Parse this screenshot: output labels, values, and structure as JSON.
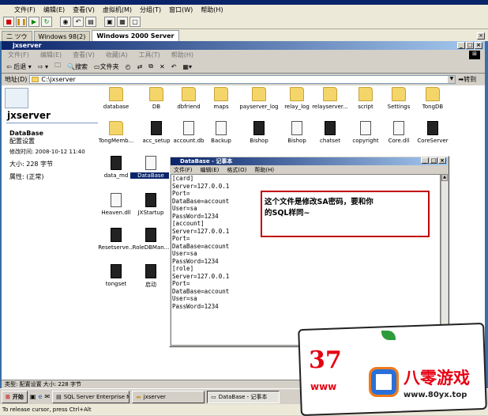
{
  "host": {
    "menu": [
      "文件(F)",
      "编辑(E)",
      "查看(V)",
      "虚拟机(M)",
      "分组(T)",
      "窗口(W)",
      "帮助(H)"
    ],
    "tabs": [
      {
        "label": "二 ツウ"
      },
      {
        "label": "Windows 98(2)"
      },
      {
        "label": "Windows 2000 Server",
        "active": true
      }
    ],
    "status_text": "To release cursor, press Ctrl+Alt"
  },
  "explorer": {
    "title": "jxserver",
    "menu": [
      "文件(F)",
      "编辑(E)",
      "查看(V)",
      "收藏(A)",
      "工具(T)",
      "帮助(H)"
    ],
    "toolbar": {
      "back": "后退",
      "search": "搜索",
      "folders": "文件夹"
    },
    "address_label": "地址(D)",
    "address_value": "C:\\jxserver",
    "go_label": "转到",
    "panel": {
      "folder_name": "jxserver",
      "file_name": "DataBase",
      "file_type": "配置设置",
      "modified": "修改时间: 2008-10-12 11:40",
      "size": "大小: 228 字节",
      "attributes": "属性: (正常)"
    },
    "icons": [
      {
        "label": "database",
        "kind": "folder"
      },
      {
        "label": "DB",
        "kind": "folder"
      },
      {
        "label": "dbfriend",
        "kind": "folder"
      },
      {
        "label": "maps",
        "kind": "folder"
      },
      {
        "label": "payserver_log",
        "kind": "folder"
      },
      {
        "label": "relay_log",
        "kind": "folder"
      },
      {
        "label": "relayserver...",
        "kind": "folder"
      },
      {
        "label": "script",
        "kind": "folder"
      },
      {
        "label": "Settings",
        "kind": "folder"
      },
      {
        "label": "TongDB",
        "kind": "folder"
      },
      {
        "label": "TongMemb...",
        "kind": "folder"
      },
      {
        "label": "acc_setup",
        "kind": "exe"
      },
      {
        "label": "account.db",
        "kind": "doc"
      },
      {
        "label": "Backup",
        "kind": "doc"
      },
      {
        "label": "Bishop",
        "kind": "exe"
      },
      {
        "label": "Bishop",
        "kind": "cfg"
      },
      {
        "label": "chatset",
        "kind": "exe"
      },
      {
        "label": "copyright",
        "kind": "doc"
      },
      {
        "label": "Core.dll",
        "kind": "dll"
      },
      {
        "label": "CoreServer",
        "kind": "exe"
      },
      {
        "label": "data_md",
        "kind": "exe"
      },
      {
        "label": "DataBase",
        "kind": "cfg",
        "selected": true
      },
      {
        "label": "Heaven.dll",
        "kind": "dll"
      },
      {
        "label": "JXStartup",
        "kind": "exe"
      },
      {
        "label": "Resetserve...",
        "kind": "exe"
      },
      {
        "label": "RoleDBMan...",
        "kind": "exe"
      },
      {
        "label": "tongset",
        "kind": "exe"
      },
      {
        "label": "启动",
        "kind": "exe"
      }
    ],
    "status": "类型: 配置设置 大小: 228 字节"
  },
  "notepad": {
    "title": "DataBase - 记事本",
    "menu": [
      "文件(F)",
      "编辑(E)",
      "格式(O)",
      "帮助(H)"
    ],
    "lines": [
      "[card]",
      "Server=127.0.0.1",
      "Port=",
      "DataBase=account",
      "User=sa",
      "PassWord=1234",
      "[account]",
      "Server=127.0.0.1",
      "Port=",
      "DataBase=account",
      "User=sa",
      "PassWord=1234",
      "[role]",
      "Server=127.0.0.1",
      "Port=",
      "DataBase=account",
      "User=sa",
      "PassWord=1234"
    ]
  },
  "annotation": {
    "line1": "这个文件是修改SA密码，要和你",
    "line2": "的SQL样同~"
  },
  "taskbar": {
    "start": "开始",
    "items": [
      {
        "label": "SQL Server Enterprise Ma..."
      },
      {
        "label": "jxserver"
      },
      {
        "label": "DataBase - 记事本",
        "active": true
      }
    ]
  },
  "watermark": {
    "number": "37",
    "brand": "八零游戏",
    "url": "www.80yx.top",
    "partial": "www"
  },
  "colors": {
    "annotation_border": "#c00000",
    "titlebar": "#0a246a",
    "brand_red": "#e60012"
  }
}
